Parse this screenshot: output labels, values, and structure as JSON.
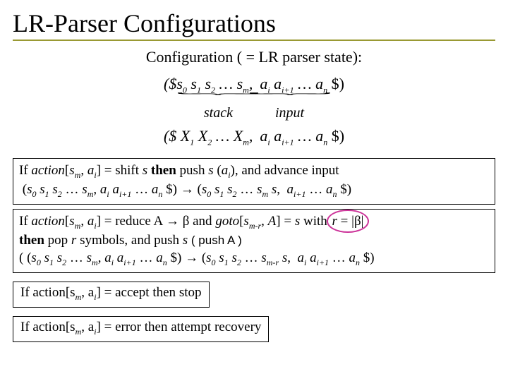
{
  "title": "LR-Parser Configurations",
  "subtitle": "Configuration ( = LR parser state):",
  "conf1_left": "($s₀ s₁ s₂ … sₘ,",
  "conf1_right": "aᵢ aᵢ₊₁ … aₙ $)",
  "brace_stack": "stack",
  "brace_input": "input",
  "conf2_left": "($ X₁ X₂ … Xₘ,",
  "conf2_right": "aᵢ aᵢ₊₁ … aₙ $)",
  "box1_l1a": "If ",
  "box1_l1b": "action",
  "box1_l1c": "[sₘ, aᵢ] = shift s ",
  "box1_l1d": "then",
  "box1_l1e": " push s (aᵢ), and advance input",
  "box1_l2": " (s₀ s₁ s₂ … sₘ, aᵢ aᵢ₊₁ … aₙ $) → (s₀ s₁ s₂ … sₘ s,  aᵢ₊₁ … aₙ $)",
  "box2_l1a": "If ",
  "box2_l1b": "action",
  "box2_l1c": "[sₘ, aᵢ] = reduce A → β and ",
  "box2_l1d": "goto",
  "box2_l1e": "[sₘ₋ᵣ, A] = s with ",
  "box2_l1f": "r = |β|",
  "box2_l2a": "then",
  "box2_l2b": " pop r symbols, and push s ",
  "box2_l2c": "( push A )",
  "box2_l3": "( (s₀ s₁ s₂ … sₘ, aᵢ aᵢ₊₁ … aₙ $) → (s₀ s₁ s₂ … sₘ₋ᵣ s,  aᵢ aᵢ₊₁ … aₙ $)",
  "box3_a": "If ",
  "box3_b": "action",
  "box3_c": "[sₘ, aᵢ] = accept ",
  "box3_d": "then",
  "box3_e": " stop",
  "box4_a": "If ",
  "box4_b": "action",
  "box4_c": "[sₘ, aᵢ] = error ",
  "box4_d": "then",
  "box4_e": " attempt recovery"
}
